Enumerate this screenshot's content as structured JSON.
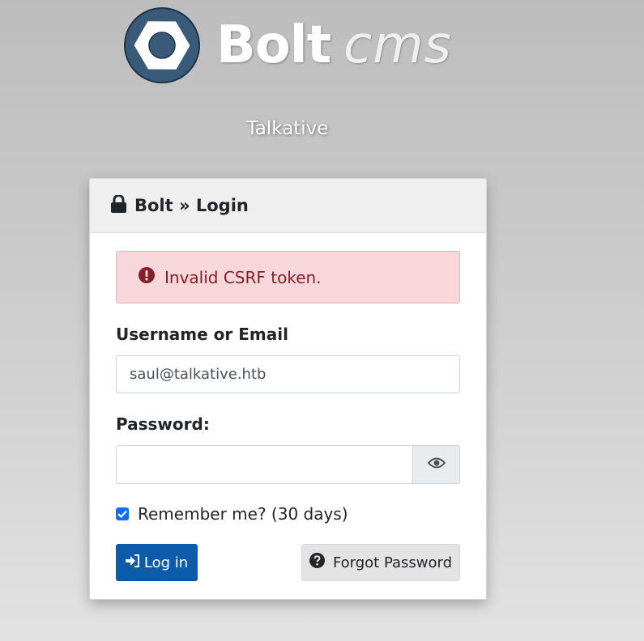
{
  "logo": {
    "word_bold": "Bolt",
    "word_italic": "cms",
    "mark_color": "#3a5a7a"
  },
  "site": {
    "name": "Talkative"
  },
  "card": {
    "title": "Bolt » Login"
  },
  "alert": {
    "message": "Invalid CSRF token."
  },
  "form": {
    "username_label": "Username or Email",
    "username_value": "saul@talkative.htb",
    "password_label": "Password:",
    "password_value": "",
    "remember_label": "Remember me? (30 days)",
    "remember_checked": true,
    "login_button": "Log in",
    "forgot_button": "Forgot Password"
  },
  "colors": {
    "primary": "#0d5cab",
    "alert_bg": "#f8d7da",
    "alert_text": "#842029",
    "checkbox": "#0d6efd"
  },
  "icons": {
    "header": "lock-icon",
    "alert": "exclamation-circle-icon",
    "password_toggle": "eye-icon",
    "login": "sign-in-icon",
    "forgot": "question-circle-icon"
  }
}
